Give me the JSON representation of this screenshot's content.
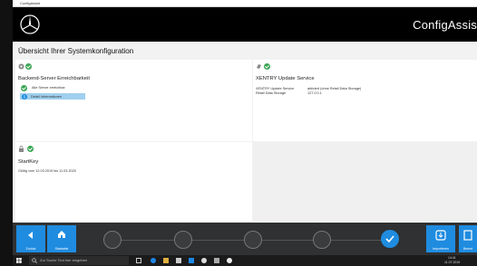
{
  "window": {
    "title": "ConfigAssist"
  },
  "header": {
    "brand": "ConfigAssis"
  },
  "page": {
    "title": "Übersicht Ihrer Systemkonfiguration"
  },
  "panels": {
    "backend": {
      "title": "Backend-Server Erreichbarkeit",
      "item_ok": "Alle Server erreichbar",
      "item_info": "Detail Informationen"
    },
    "xentry": {
      "title": "XENTRY Update Service",
      "rows": [
        {
          "key": "XENTRY Update Service",
          "value": "aktiviert (ohne Retail Data Storage)"
        },
        {
          "key": "Retail Data Storage",
          "value": "127.0.0.1"
        }
      ]
    },
    "startkey": {
      "title": "StartKey",
      "validity": "Gültig vom 12.03.2019 bis 11.03.2020"
    }
  },
  "bottom": {
    "back_label": "Zurück",
    "home_label": "Startseite",
    "next_label": "Importieren",
    "last_label": "Beend"
  },
  "taskbar": {
    "search_placeholder": "Zur Suche Text hier eingeben",
    "time": "14:41",
    "date": "11.07.2019"
  },
  "colors": {
    "accent": "#1f8ce0",
    "ok": "#3aa655",
    "header_bg": "#000000"
  }
}
